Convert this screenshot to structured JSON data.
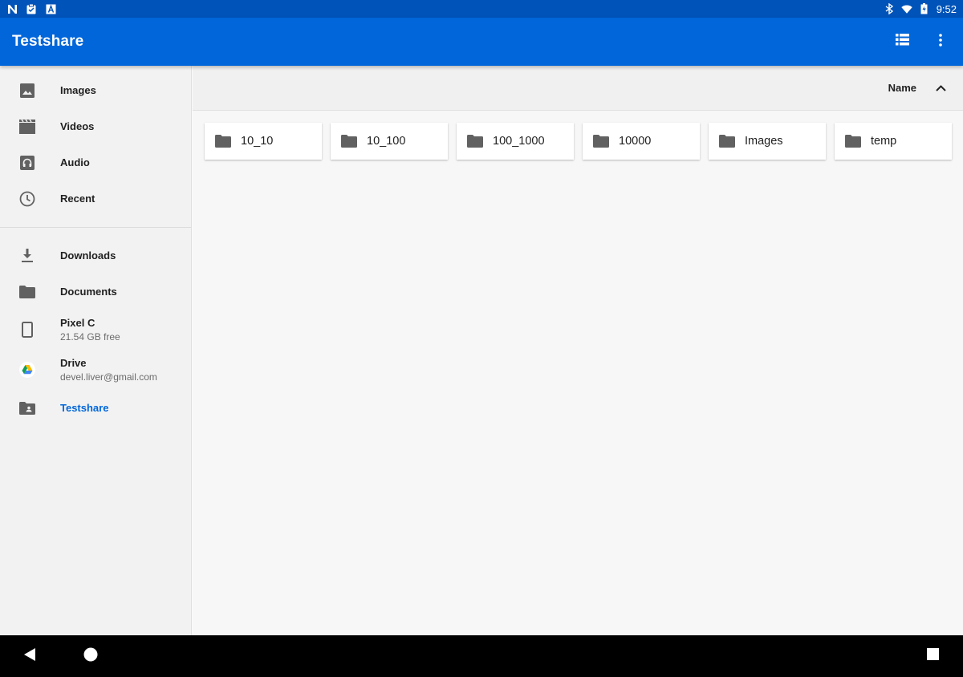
{
  "status_bar": {
    "time": "9:52",
    "left_icons": [
      "notification-n-icon",
      "clipboard-icon",
      "app-a-icon"
    ],
    "right_icons": [
      "bluetooth-icon",
      "wifi-icon",
      "battery-icon"
    ]
  },
  "app_bar": {
    "title": "Testshare",
    "actions": [
      "list-view-icon",
      "more-vert-icon"
    ]
  },
  "drawer": {
    "roots": [
      {
        "label": "Images",
        "icon": "image-icon"
      },
      {
        "label": "Videos",
        "icon": "video-icon"
      },
      {
        "label": "Audio",
        "icon": "headphones-icon"
      },
      {
        "label": "Recent",
        "icon": "clock-icon"
      }
    ],
    "devices": [
      {
        "label": "Downloads",
        "icon": "download-icon"
      },
      {
        "label": "Documents",
        "icon": "folder-icon"
      },
      {
        "label": "Pixel C",
        "sub": "21.54 GB free",
        "icon": "phone-icon"
      },
      {
        "label": "Drive",
        "sub": "devel.liver@gmail.com",
        "icon": "drive-icon"
      },
      {
        "label": "Testshare",
        "icon": "shared-folder-icon",
        "active": true
      }
    ]
  },
  "sort": {
    "label": "Name",
    "direction": "ascending"
  },
  "folders": [
    "10_10",
    "10_100",
    "100_1000",
    "10000",
    "Images",
    "temp"
  ],
  "colors": {
    "status_bar": "#0053b8",
    "app_bar": "#0066d9",
    "accent": "#0066d9",
    "icon_gray": "#616161"
  }
}
